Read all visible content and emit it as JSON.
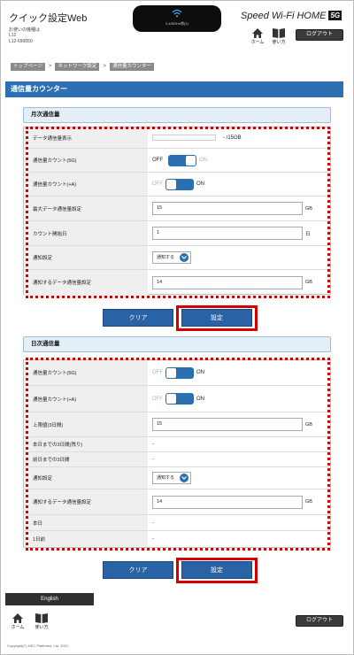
{
  "header": {
    "app_title": "クイック設定Web",
    "device_line1": "お使いの機種は",
    "device_line2": "L12",
    "device_line3": "L12-690050",
    "status_text": "2.4/5GHz帯(1)",
    "brand_name": "Speed Wi-Fi HOME",
    "brand_5g": "5G",
    "home_label": "ホーム",
    "guide_label": "使い方",
    "logout_label": "ログアウト"
  },
  "breadcrumb": [
    "トップページ",
    "ネットワーク設定",
    "通信量カウンター"
  ],
  "page_title": "通信量カウンター",
  "monthly": {
    "section_title": "月次通信量",
    "rows": {
      "usage_display": {
        "label": "データ通信量表示",
        "value": "- /15GB"
      },
      "count_5g": {
        "label": "通信量カウント(5G)",
        "off": "OFF",
        "on": "ON"
      },
      "count_4g": {
        "label": "通信量カウント(+A)",
        "off": "OFF",
        "on": "ON"
      },
      "max_setting": {
        "label": "最大データ通信量設定",
        "value": "15",
        "unit": "GB"
      },
      "start_day": {
        "label": "カウント開始日",
        "value": "1",
        "unit": "日"
      },
      "notify": {
        "label": "通知設定",
        "value": "通知する"
      },
      "notify_amount": {
        "label": "通知するデータ通信量設定",
        "value": "14",
        "unit": "GB"
      }
    },
    "clear_label": "クリア",
    "set_label": "設定"
  },
  "daily": {
    "section_title": "日次通信量",
    "rows": {
      "count_5g": {
        "label": "通信量カウント(5G)",
        "off": "OFF",
        "on": "ON"
      },
      "count_4g": {
        "label": "通信量カウント(+A)",
        "off": "OFF",
        "on": "ON"
      },
      "limit": {
        "label": "上限値(3日間)",
        "value": "15",
        "unit": "GB"
      },
      "until_today": {
        "label": "本日までの3日間(残り)",
        "value": "-"
      },
      "until_yesterday": {
        "label": "前日までの3日間",
        "value": "-"
      },
      "notify": {
        "label": "通知設定",
        "value": "通知する"
      },
      "notify_amount": {
        "label": "通知するデータ通信量設定",
        "value": "14",
        "unit": "GB"
      },
      "today": {
        "label": "本日",
        "value": "-"
      },
      "yesterday": {
        "label": "1日前",
        "value": "-"
      }
    },
    "clear_label": "クリア",
    "set_label": "設定"
  },
  "footer": {
    "english_label": "English",
    "home_label": "ホーム",
    "guide_label": "使い方",
    "logout_label": "ログアウト",
    "copyright": "Copyright(C) NEC Platforms, Ltd. 2021"
  },
  "colors": {
    "accent": "#2a6fb0",
    "highlight": "#d40000"
  }
}
